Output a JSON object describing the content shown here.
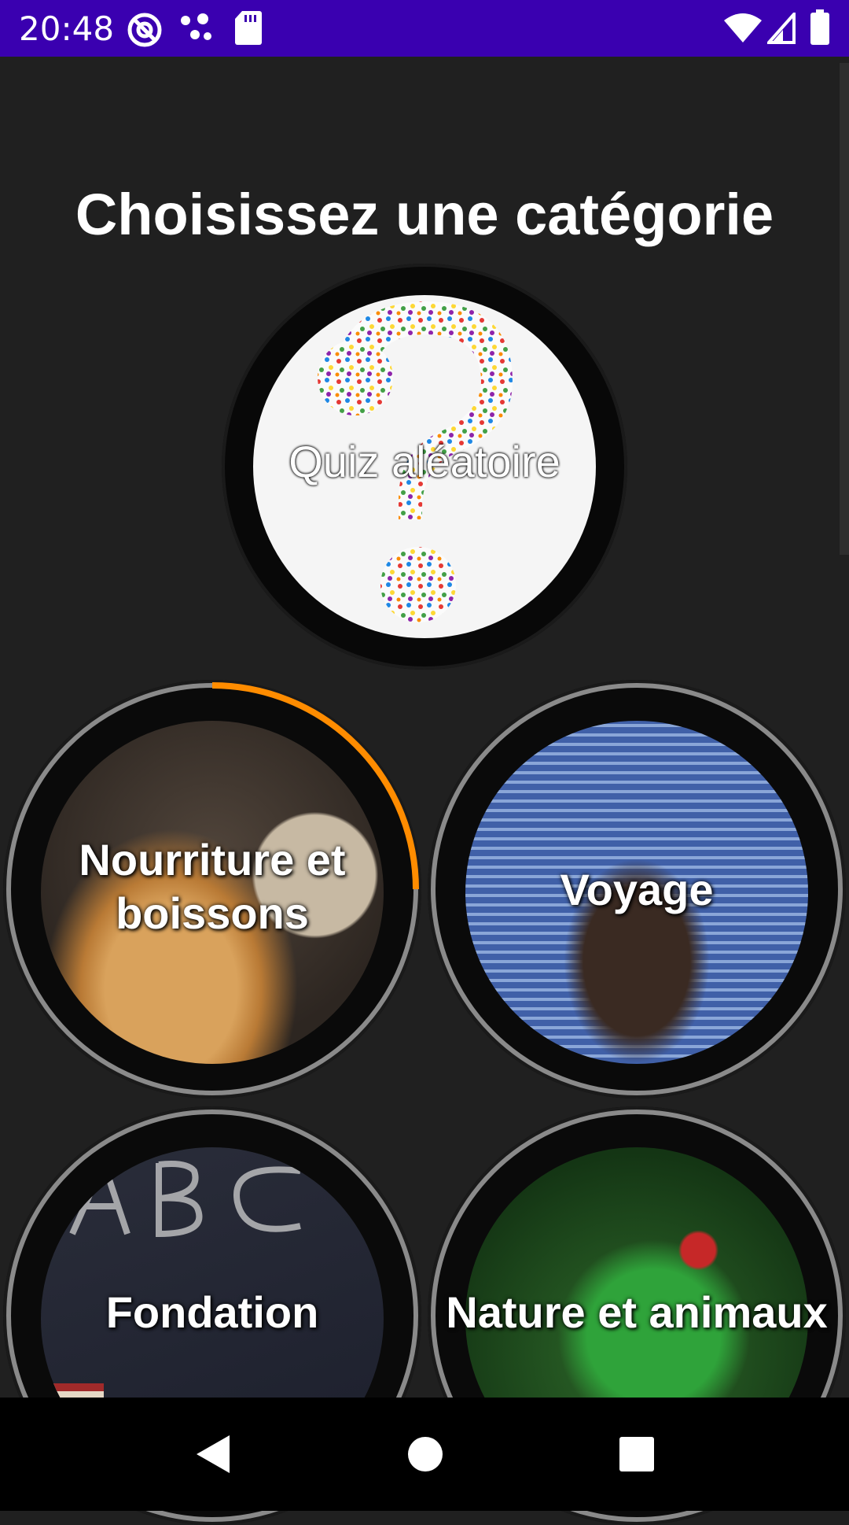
{
  "status_bar": {
    "time": "20:48",
    "left_icons": [
      "at-sign-icon",
      "dots-icon",
      "sd-card-icon"
    ],
    "right_icons": [
      "wifi-icon",
      "signal-icon",
      "battery-icon"
    ],
    "background": "#3a00b0"
  },
  "page": {
    "title": "Choisissez une catégorie"
  },
  "categories": [
    {
      "label": "Quiz aléatoire"
    },
    {
      "label_line1": "Nourriture et",
      "label_line2": "boissons"
    },
    {
      "label": "Voyage"
    },
    {
      "label": "Fondation"
    },
    {
      "label": "Nature et animaux"
    }
  ],
  "colors": {
    "background": "#202020",
    "progress_accent": "#ff8c00"
  },
  "nav_bar": {
    "buttons": [
      "back-icon",
      "home-icon",
      "recents-icon"
    ]
  }
}
